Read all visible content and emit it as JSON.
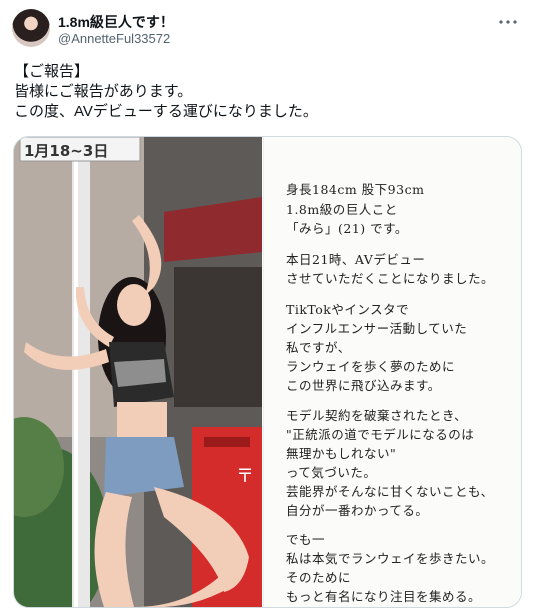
{
  "author": {
    "name": "1.8m級巨人です！",
    "handle": "@AnnetteFul33572"
  },
  "more_icon": "more-horizontal-icon",
  "tweet_lines": [
    "【ご報告】",
    "皆様にご報告があります。",
    "この度、AVデビューする運びになりました。"
  ],
  "photo": {
    "sign_text": "1月18~3日"
  },
  "note_lines": [
    "身長184cm 股下93cm",
    "1.8m級の巨人こと",
    "「みら」(21) です。",
    "本日21時、AVデビュー",
    "させていただくことになりました。",
    "TikTokやインスタで",
    "インフルエンサー活動していた",
    "私ですが、",
    "ランウェイを歩く夢のために",
    "この世界に飛び込みます。",
    "モデル契約を破棄されたとき、",
    "\"正統派の道でモデルになるのは",
    "無理かもしれない\"",
    "って気づいた。",
    "芸能界がそんなに甘くないことも、",
    "自分が一番わかってる。",
    "でも一",
    "私は本気でランウェイを歩きたい。",
    "そのために",
    "もっと有名になり注目を集める。"
  ]
}
